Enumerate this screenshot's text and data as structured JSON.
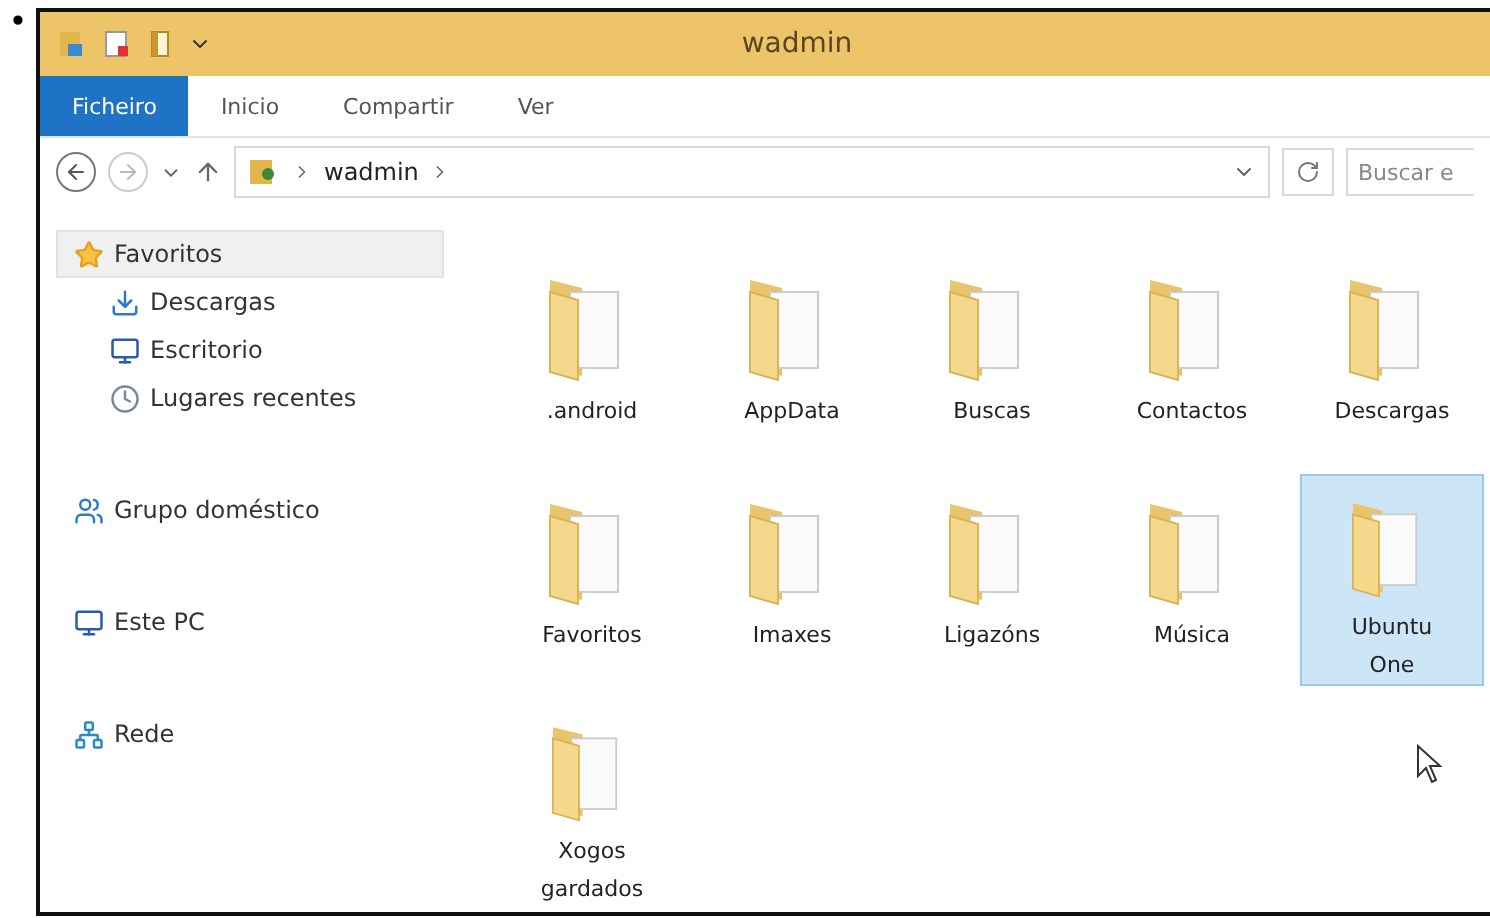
{
  "bullet": "•",
  "window": {
    "title": "wadmin"
  },
  "ribbon_tabs": [
    {
      "label": "Ficheiro",
      "kind": "file"
    },
    {
      "label": "Inicio",
      "kind": "tab"
    },
    {
      "label": "Compartir",
      "kind": "tab"
    },
    {
      "label": "Ver",
      "kind": "tab"
    }
  ],
  "address_bar": {
    "path": [
      "wadmin"
    ],
    "forward_disabled": true
  },
  "search": {
    "placeholder": "Buscar e"
  },
  "sidebar": {
    "items": [
      {
        "label": "Favoritos",
        "selected": true,
        "children": [
          {
            "label": "Descargas",
            "selected": false
          },
          {
            "label": "Escritorio",
            "selected": false
          },
          {
            "label": "Lugares recentes",
            "selected": false
          }
        ]
      },
      {
        "label": "Grupo doméstico",
        "selected": false
      },
      {
        "label": "Este PC",
        "selected": false
      },
      {
        "label": "Rede",
        "selected": false
      }
    ]
  },
  "folders": [
    {
      "name": ".android",
      "selected": false
    },
    {
      "name": "AppData",
      "selected": false
    },
    {
      "name": "Buscas",
      "selected": false
    },
    {
      "name": "Contactos",
      "selected": false
    },
    {
      "name": "Descargas",
      "selected": false
    },
    {
      "name": "Favoritos",
      "selected": false
    },
    {
      "name": "Imaxes",
      "selected": false
    },
    {
      "name": "Ligazóns",
      "selected": false
    },
    {
      "name": "Música",
      "selected": false
    },
    {
      "name": "Ubuntu One",
      "selected": true
    },
    {
      "name": "Xogos gardados",
      "selected": false
    }
  ]
}
